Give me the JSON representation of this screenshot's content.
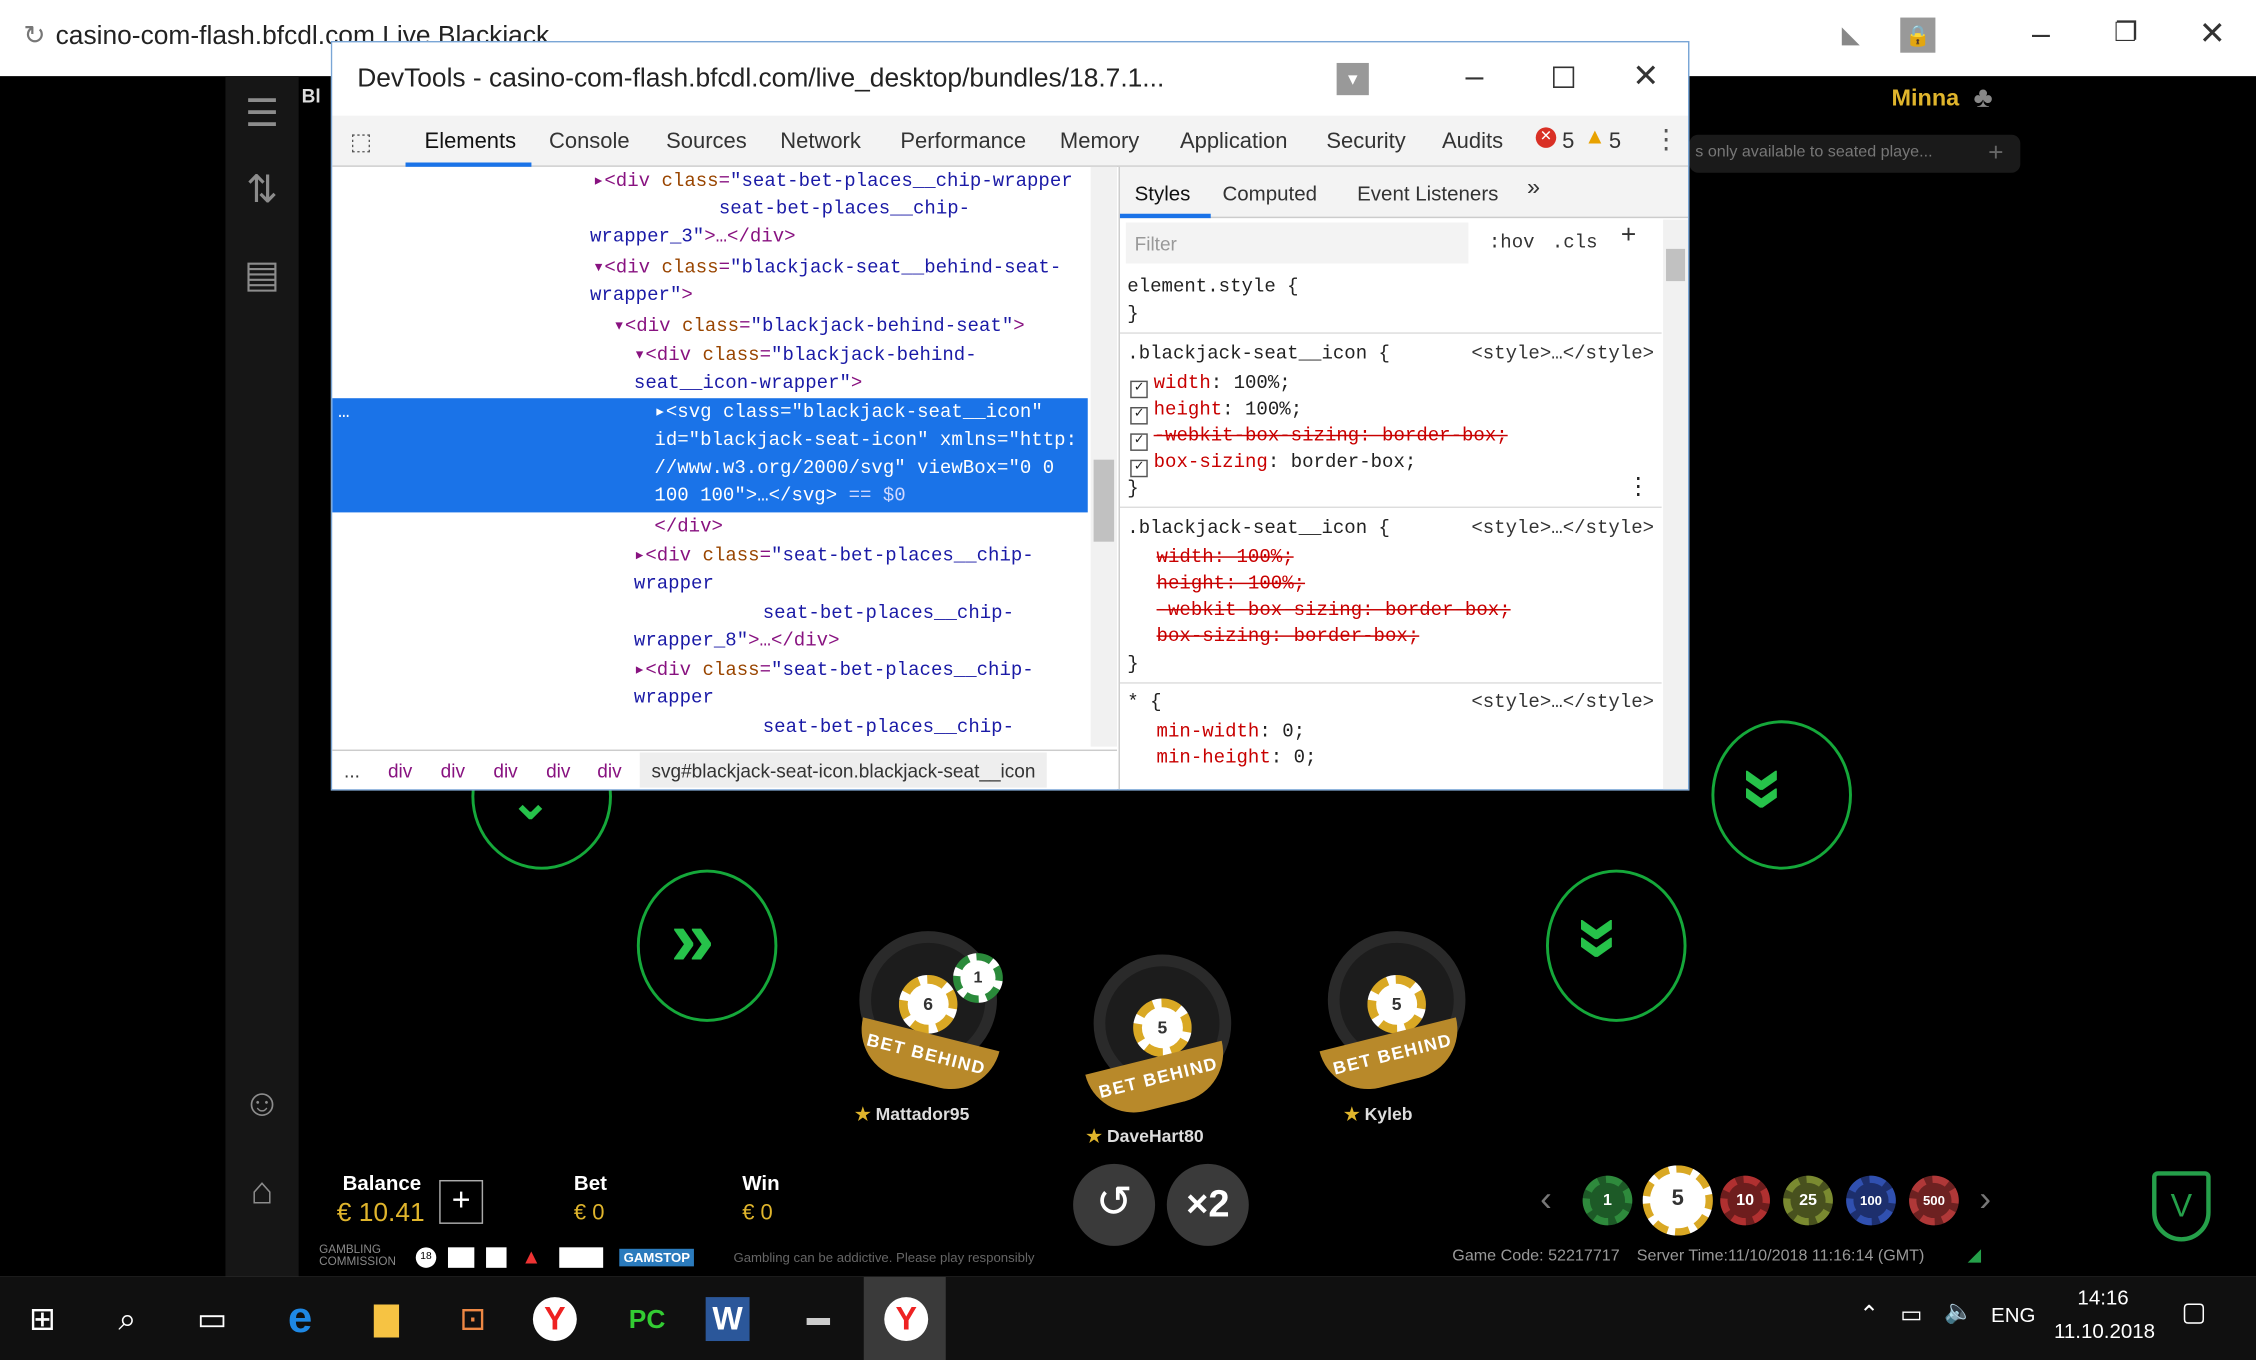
{
  "browser": {
    "url_title": "casino-com-flash.bfcdl.com  Live Blackjack",
    "user": "Minna",
    "notice": "s only available to seated playe..."
  },
  "devtools": {
    "title": "DevTools - casino-com-flash.bfcdl.com/live_desktop/bundles/18.7.1...",
    "tabs": [
      "Elements",
      "Console",
      "Sources",
      "Network",
      "Performance",
      "Memory",
      "Application",
      "Security",
      "Audits"
    ],
    "errors": "5",
    "warnings": "5",
    "style_tabs": [
      "Styles",
      "Computed",
      "Event Listeners"
    ],
    "filter_placeholder": "Filter",
    "hov": ":hov",
    "cls": ".cls",
    "breadcrumb": [
      "...",
      "div",
      "div",
      "div",
      "div",
      "div",
      "svg#blackjack-seat-icon.blackjack-seat__icon"
    ]
  },
  "game": {
    "balance_label": "Balance",
    "balance": "€ 10.41",
    "bet_label": "Bet",
    "bet": "€ 0",
    "win_label": "Win",
    "win": "€ 0",
    "bet_behind": "BET BEHIND",
    "players": [
      "Mattador95",
      "DaveHart80",
      "Kyleb"
    ],
    "chip_values": [
      "1",
      "5",
      "10",
      "25",
      "100",
      "500"
    ],
    "game_code": "Game Code: 52217717",
    "server_time": "Server Time:11/10/2018 11:16:14 (GMT)",
    "responsible": "Gambling can be addictive. Please play responsibly",
    "gamstop": "GAMSTOP",
    "stack_values": [
      "6",
      "1",
      "5",
      "5"
    ]
  },
  "taskbar": {
    "time": "14:16",
    "date": "11.10.2018",
    "lang": "ENG"
  },
  "colors": {
    "accent_green": "#26c24a",
    "devtools_select": "#1a73e8",
    "gold": "#e0b52c"
  }
}
